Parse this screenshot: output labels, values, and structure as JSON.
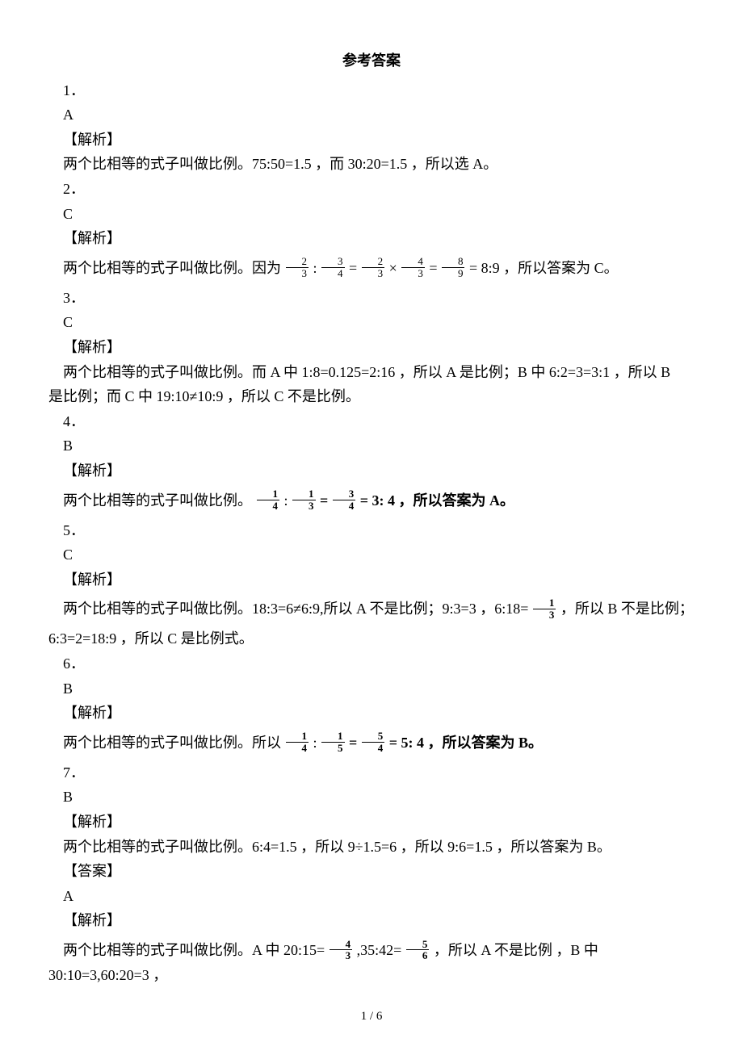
{
  "title": "参考答案",
  "items": {
    "q1": {
      "num": "1．",
      "ans": "A",
      "label": "【解析】",
      "expl": "两个比相等的式子叫做比例。75:50=1.5 ，而 30:20=1.5 ，所以选 A。"
    },
    "q2": {
      "num": "2．",
      "ans": "C",
      "label": "【解析】",
      "p_a": "两个比相等的式子叫做比例。因为",
      "f1n": "2",
      "f1d": "3",
      "f2n": "3",
      "f2d": "4",
      "f3n": "2",
      "f3d": "3",
      "f4n": "4",
      "f4d": "3",
      "f5n": "8",
      "f5d": "9",
      "colon": ":",
      "eq": "=",
      "times": "×",
      "p_b": "8:9 ，所以答案为 C。"
    },
    "q3": {
      "num": "3．",
      "ans": "C",
      "label": "【解析】",
      "l1": "两个比相等的式子叫做比例。而 A 中 1:8=0.125=2:16 ，所以 A 是比例；B 中 6:2=3=3:1 ，所以 B",
      "l2": "是比例；而 C 中 19:10≠10:9 ，所以 C 不是比例。"
    },
    "q4": {
      "num": "4．",
      "ans": "B",
      "label": "【解析】",
      "p_a": "两个比相等的式子叫做比例。",
      "f1n": "1",
      "f1d": "4",
      "colon": ":",
      "f2n": "1",
      "f2d": "3",
      "eq": " = ",
      "f3n": "3",
      "f3d": "4",
      "p_b": " = 3: 4 ，所以答案为 A。"
    },
    "q5": {
      "num": "5．",
      "ans": "C",
      "label": "【解析】",
      "p_a": "两个比相等的式子叫做比例。18:3=6≠6:9,所以 A 不是比例；9:3=3 ，6:18=",
      "f1n": "1",
      "f1d": "3",
      "p_b": " ，所以 B 不是比例；",
      "l2": "6:3=2=18:9 ，所以 C 是比例式。"
    },
    "q6": {
      "num": "6．",
      "ans": "B",
      "label": "【解析】",
      "p_a": "两个比相等的式子叫做比例。所以",
      "f1n": "1",
      "f1d": "4",
      "colon": ":",
      "f2n": "1",
      "f2d": "5",
      "eq": " = ",
      "f3n": "5",
      "f3d": "4",
      "p_b": " = 5: 4 ，所以答案为 B。"
    },
    "q7": {
      "num": "7．",
      "ans": "B",
      "label": "【解析】",
      "expl": "两个比相等的式子叫做比例。6:4=1.5 ，所以 9÷1.5=6 ，所以 9:6=1.5 ，所以答案为 B。"
    },
    "q8": {
      "ans_label": "【答案】",
      "ans": "A",
      "label": "【解析】",
      "p_a": "两个比相等的式子叫做比例。A 中 20:15=",
      "f1n": "4",
      "f1d": "3",
      "mid": ",35:42=",
      "f2n": "5",
      "f2d": "6",
      "p_b": " ，所以 A 不是比例 ，B 中 30:10=3,60:20=3 ，"
    }
  },
  "footer": "1 / 6"
}
